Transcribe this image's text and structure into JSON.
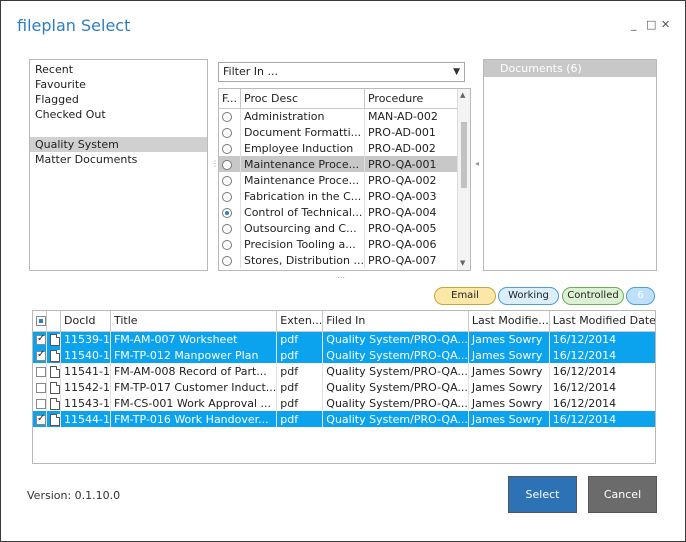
{
  "window": {
    "title": "fileplan Select",
    "minimize_glyph": "_",
    "maximize_glyph": "□",
    "close_glyph": "✕"
  },
  "nav": {
    "items": [
      "Recent",
      "Favourite",
      "Flagged",
      "Checked Out",
      "",
      "Quality System",
      "Matter Documents"
    ],
    "selected": "Quality System"
  },
  "filter": {
    "label": "Filter In ...",
    "arrow": "▼"
  },
  "procedures": {
    "columns": [
      "F...",
      "Proc Desc",
      "Procedure"
    ],
    "rows": [
      {
        "desc": "Administration",
        "code": "MAN-AD-002",
        "on": false
      },
      {
        "desc": "Document Formatti...",
        "code": "PRO-AD-001",
        "on": false
      },
      {
        "desc": "Employee Induction",
        "code": "PRO-AD-002",
        "on": false
      },
      {
        "desc": "Maintenance Proce...",
        "code": "PRO-QA-001",
        "on": false
      },
      {
        "desc": "Maintenance Proce...",
        "code": "PRO-QA-002",
        "on": false
      },
      {
        "desc": "Fabrication in the C...",
        "code": "PRO-QA-003",
        "on": false
      },
      {
        "desc": "Control of Technical...",
        "code": "PRO-QA-004",
        "on": true
      },
      {
        "desc": "Outsourcing and C...",
        "code": "PRO-QA-005",
        "on": false
      },
      {
        "desc": "Precision Tooling a...",
        "code": "PRO-QA-006",
        "on": false
      },
      {
        "desc": "Stores, Distribution ...",
        "code": "PRO-QA-007",
        "on": false
      }
    ],
    "selected_code": "PRO-QA-001"
  },
  "documents_panel": {
    "header": "Documents (6)"
  },
  "filters": {
    "email": "Email",
    "working": "Working",
    "controlled": "Controlled",
    "count": "6"
  },
  "grid": {
    "columns": [
      "",
      "",
      "DocId",
      "Title",
      "Exten...",
      "Filed In",
      "Last Modifie...",
      "Last Modified Date"
    ],
    "rows": [
      {
        "checked": true,
        "docid": "11539-1",
        "title": "FM-AM-007 Worksheet",
        "ext": "pdf",
        "filed": "Quality System/PRO-QA...",
        "by": "James Sowry",
        "date": "16/12/2014",
        "sel": true
      },
      {
        "checked": true,
        "docid": "11540-1",
        "title": "FM-TP-012  Manpower Plan",
        "ext": "pdf",
        "filed": "Quality System/PRO-QA...",
        "by": "James Sowry",
        "date": "16/12/2014",
        "sel": true
      },
      {
        "checked": false,
        "docid": "11541-1",
        "title": "FM-AM-008 Record of Part...",
        "ext": "pdf",
        "filed": "Quality System/PRO-QA...",
        "by": "James Sowry",
        "date": "16/12/2014",
        "sel": false
      },
      {
        "checked": false,
        "docid": "11542-1",
        "title": "FM-TP-017 Customer Induct...",
        "ext": "pdf",
        "filed": "Quality System/PRO-QA...",
        "by": "James Sowry",
        "date": "16/12/2014",
        "sel": false
      },
      {
        "checked": false,
        "docid": "11543-1",
        "title": "FM-CS-001 Work Approval ...",
        "ext": "pdf",
        "filed": "Quality System/PRO-QA...",
        "by": "James Sowry",
        "date": "16/12/2014",
        "sel": false
      },
      {
        "checked": true,
        "docid": "11544-1",
        "title": "FM-TP-016 Work Handover...",
        "ext": "pdf",
        "filed": "Quality System/PRO-QA...",
        "by": "James Sowry",
        "date": "16/12/2014",
        "sel": true
      }
    ]
  },
  "footer": {
    "version": "Version: 0.1.10.0",
    "select": "Select",
    "cancel": "Cancel"
  },
  "colors": {
    "accent": "#2b7fc2",
    "row_selected": "#0ba3ee",
    "select_button": "#2e72b6",
    "cancel_button": "#6b6b6b"
  }
}
